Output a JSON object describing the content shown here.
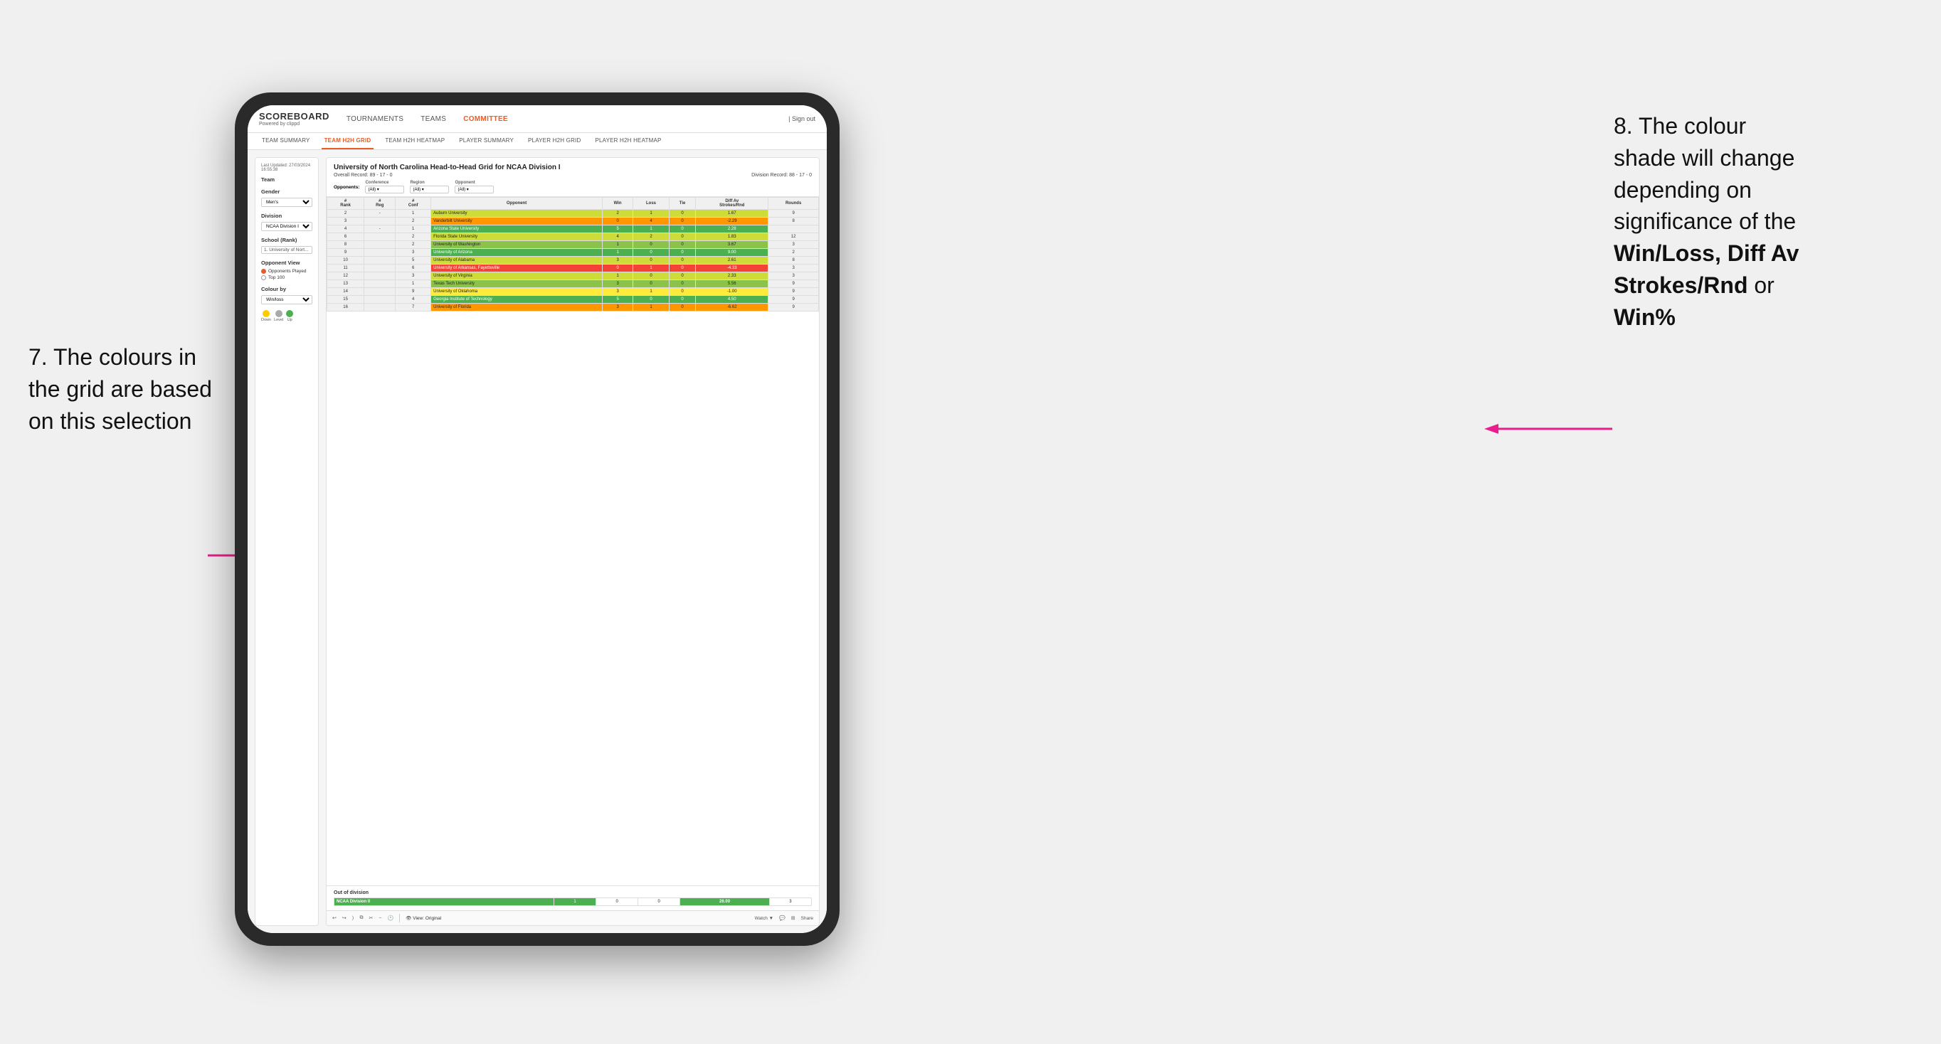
{
  "annotation_left": {
    "line1": "7. The colours in",
    "line2": "the grid are based",
    "line3": "on this selection"
  },
  "annotation_right": {
    "line1": "8. The colour",
    "line2": "shade will change",
    "line3": "depending on",
    "line4": "significance of the",
    "bold1": "Win/Loss",
    "comma1": ", ",
    "bold2": "Diff Av",
    "bold3": "Strokes/Rnd",
    "line5": " or",
    "bold4": "Win%"
  },
  "app": {
    "logo": "SCOREBOARD",
    "logo_sub": "Powered by clippd",
    "nav": [
      "TOURNAMENTS",
      "TEAMS",
      "COMMITTEE"
    ],
    "sign_out": "| Sign out"
  },
  "sub_nav": [
    "TEAM SUMMARY",
    "TEAM H2H GRID",
    "TEAM H2H HEATMAP",
    "PLAYER SUMMARY",
    "PLAYER H2H GRID",
    "PLAYER H2H HEATMAP"
  ],
  "left_panel": {
    "timestamp_label": "Last Updated: 27/03/2024",
    "timestamp_time": "16:55:38",
    "team_label": "Team",
    "gender_label": "Gender",
    "gender_value": "Men's",
    "division_label": "Division",
    "division_value": "NCAA Division I",
    "school_label": "School (Rank)",
    "school_value": "1. University of Nort...",
    "opponent_view_label": "Opponent View",
    "opponent_options": [
      "Opponents Played",
      "Top 100"
    ],
    "opponent_selected": "Opponents Played",
    "colour_by_label": "Colour by",
    "colour_by_value": "Win/loss",
    "legend": {
      "down_label": "Down",
      "level_label": "Level",
      "up_label": "Up",
      "down_color": "#ffcc00",
      "level_color": "#aaaaaa",
      "up_color": "#4caf50"
    }
  },
  "grid": {
    "title": "University of North Carolina Head-to-Head Grid for NCAA Division I",
    "overall_record": "Overall Record: 89 - 17 - 0",
    "division_record": "Division Record: 88 - 17 - 0",
    "filters": {
      "opponents_label": "Opponents:",
      "conference_label": "Conference",
      "conference_value": "(All)",
      "region_label": "Region",
      "region_value": "(All)",
      "opponent_label": "Opponent",
      "opponent_value": "(All)"
    },
    "columns": [
      "#\nRank",
      "#\nReg",
      "#\nConf",
      "Opponent",
      "Win",
      "Loss",
      "Tie",
      "Diff Av\nStrokes/Rnd",
      "Rounds"
    ],
    "rows": [
      {
        "rank": "2",
        "reg": "-",
        "conf": "1",
        "opponent": "Auburn University",
        "win": "2",
        "loss": "1",
        "tie": "0",
        "diff": "1.67",
        "rounds": "9",
        "color": "green-light"
      },
      {
        "rank": "3",
        "reg": "",
        "conf": "2",
        "opponent": "Vanderbilt University",
        "win": "0",
        "loss": "4",
        "tie": "0",
        "diff": "-2.29",
        "rounds": "8",
        "color": "orange"
      },
      {
        "rank": "4",
        "reg": "-",
        "conf": "1",
        "opponent": "Arizona State University",
        "win": "5",
        "loss": "1",
        "tie": "0",
        "diff": "2.28",
        "rounds": "",
        "color": "green-dark"
      },
      {
        "rank": "6",
        "reg": "",
        "conf": "2",
        "opponent": "Florida State University",
        "win": "4",
        "loss": "2",
        "tie": "0",
        "diff": "1.83",
        "rounds": "12",
        "color": "green-light"
      },
      {
        "rank": "8",
        "reg": "",
        "conf": "2",
        "opponent": "University of Washington",
        "win": "1",
        "loss": "0",
        "tie": "0",
        "diff": "3.67",
        "rounds": "3",
        "color": "green-med"
      },
      {
        "rank": "9",
        "reg": "",
        "conf": "3",
        "opponent": "University of Arizona",
        "win": "1",
        "loss": "0",
        "tie": "0",
        "diff": "9.00",
        "rounds": "2",
        "color": "green-dark"
      },
      {
        "rank": "10",
        "reg": "",
        "conf": "5",
        "opponent": "University of Alabama",
        "win": "3",
        "loss": "0",
        "tie": "0",
        "diff": "2.61",
        "rounds": "8",
        "color": "green-light"
      },
      {
        "rank": "11",
        "reg": "",
        "conf": "6",
        "opponent": "University of Arkansas, Fayetteville",
        "win": "0",
        "loss": "1",
        "tie": "0",
        "diff": "-4.33",
        "rounds": "3",
        "color": "orange-dark"
      },
      {
        "rank": "12",
        "reg": "",
        "conf": "3",
        "opponent": "University of Virginia",
        "win": "1",
        "loss": "0",
        "tie": "0",
        "diff": "2.33",
        "rounds": "3",
        "color": "green-light"
      },
      {
        "rank": "13",
        "reg": "",
        "conf": "1",
        "opponent": "Texas Tech University",
        "win": "3",
        "loss": "0",
        "tie": "0",
        "diff": "5.56",
        "rounds": "9",
        "color": "green-med"
      },
      {
        "rank": "14",
        "reg": "",
        "conf": "9",
        "opponent": "University of Oklahoma",
        "win": "3",
        "loss": "1",
        "tie": "0",
        "diff": "-1.00",
        "rounds": "9",
        "color": "yellow"
      },
      {
        "rank": "15",
        "reg": "",
        "conf": "4",
        "opponent": "Georgia Institute of Technology",
        "win": "5",
        "loss": "0",
        "tie": "0",
        "diff": "4.50",
        "rounds": "9",
        "color": "green-dark"
      },
      {
        "rank": "16",
        "reg": "",
        "conf": "7",
        "opponent": "University of Florida",
        "win": "3",
        "loss": "1",
        "tie": "0",
        "diff": "-6.62",
        "rounds": "9",
        "color": "orange"
      }
    ],
    "out_of_division": {
      "label": "Out of division",
      "rows": [
        {
          "division": "NCAA Division II",
          "win": "1",
          "loss": "0",
          "tie": "0",
          "diff": "26.00",
          "rounds": "3"
        }
      ]
    }
  },
  "toolbar": {
    "view_label": "View: Original",
    "watch_label": "Watch ▼",
    "share_label": "Share"
  }
}
